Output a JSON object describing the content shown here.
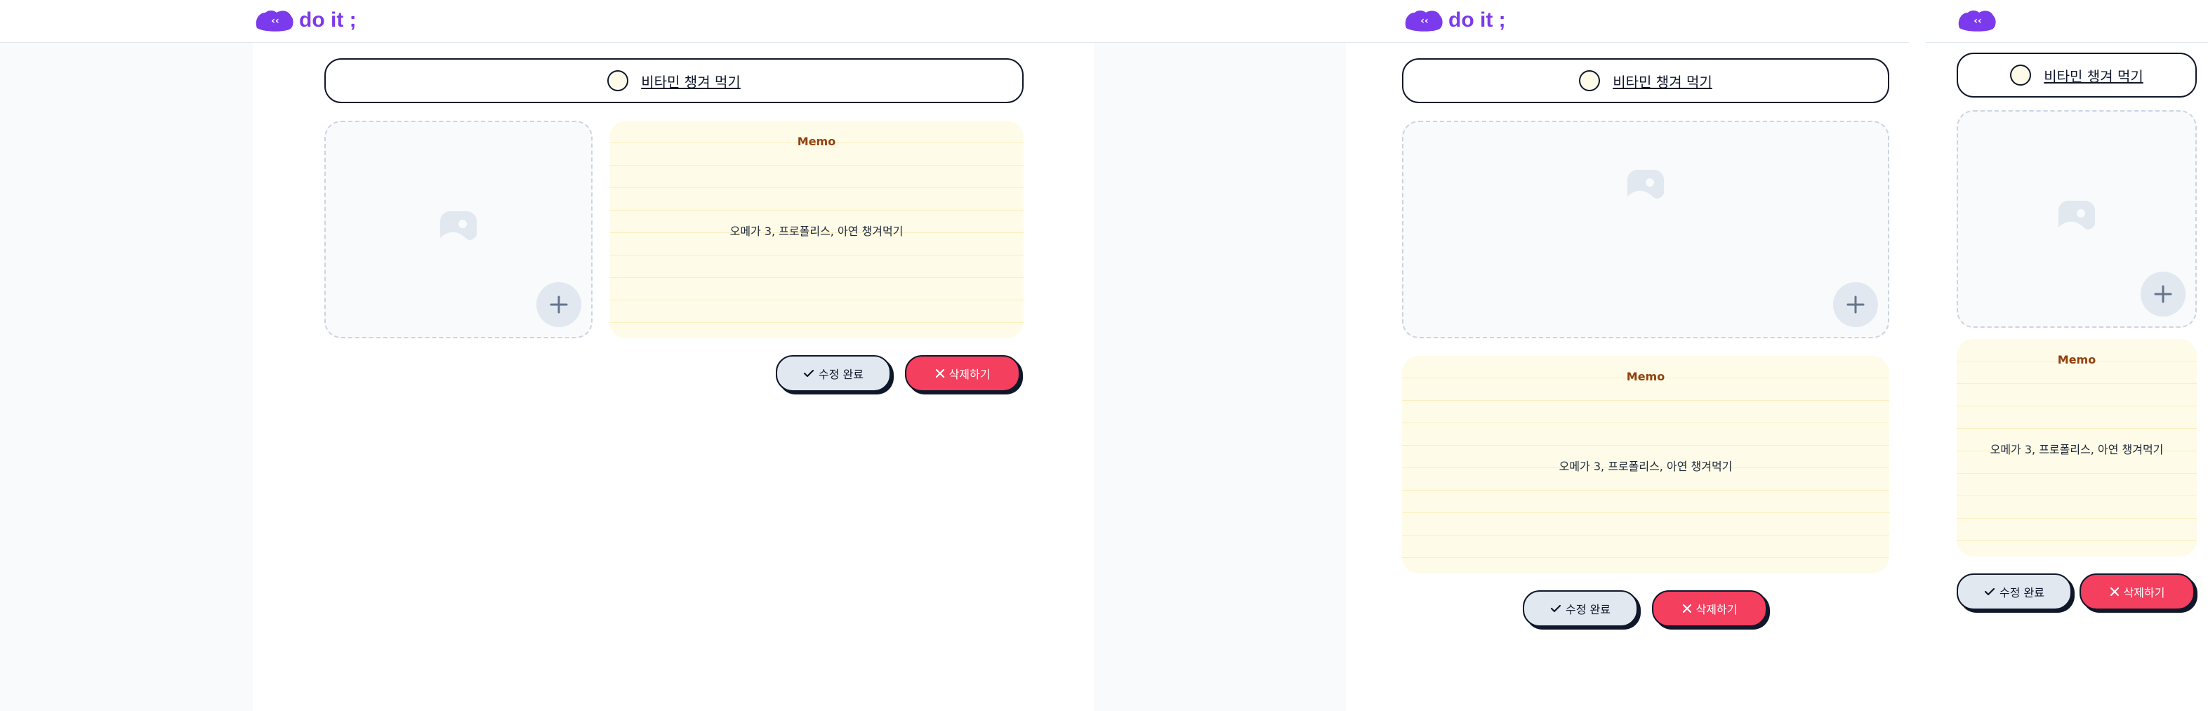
{
  "app": {
    "logo_text": "do it ;",
    "logo_mark_text": "‹‹"
  },
  "todo": {
    "title": "비타민 챙겨 먹기"
  },
  "memo": {
    "title": "Memo",
    "content": "오메가 3, 프로폴리스, 아연 챙겨먹기"
  },
  "actions": {
    "done_label": "수정 완료",
    "delete_label": "삭제하기"
  },
  "colors": {
    "brand": "#7c3aed",
    "memo_bg": "#fefce8",
    "memo_title": "#92400e",
    "delete": "#f43f5e",
    "done": "#e2e8f0"
  }
}
